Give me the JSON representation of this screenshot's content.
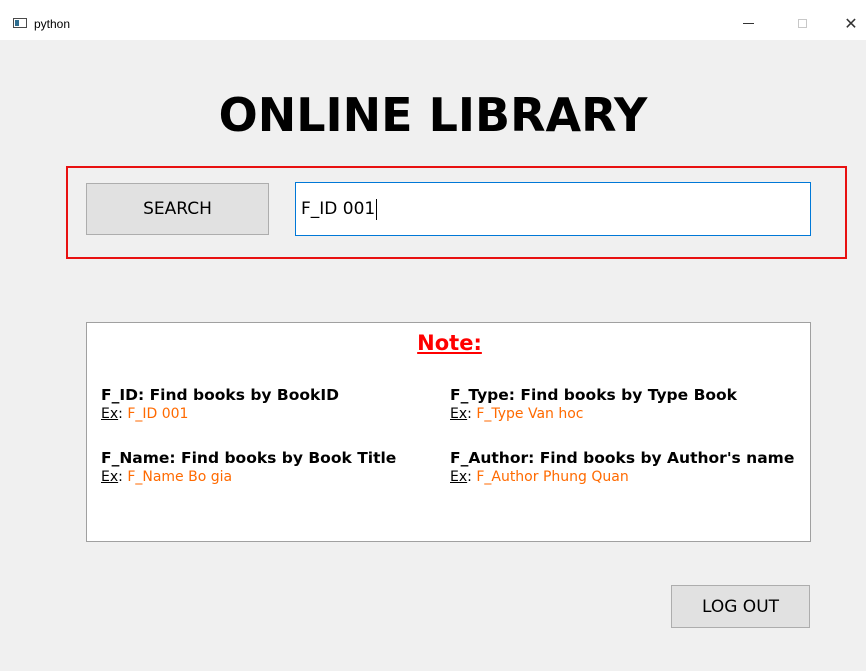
{
  "window": {
    "title": "python",
    "minimize_glyph": "—",
    "close_glyph": "✕"
  },
  "main": {
    "title": "ONLINE LIBRARY"
  },
  "search": {
    "button_label": "SEARCH",
    "input_value": "F_ID 001"
  },
  "note": {
    "title": "Note:",
    "example_label": "Ex",
    "example_colon": ": ",
    "items": [
      {
        "heading": "F_ID: Find books by BookID",
        "example": "F_ID 001"
      },
      {
        "heading": "F_Type: Find books by Type Book",
        "example": "F_Type Van hoc"
      },
      {
        "heading": "F_Name: Find books by Book Title",
        "example": "F_Name Bo gia"
      },
      {
        "heading": "F_Author: Find books by Author's name",
        "example": "F_Author Phung Quan"
      }
    ]
  },
  "footer": {
    "logout_label": "LOG OUT"
  },
  "colors": {
    "frame_red": "#e81010",
    "note_title_red": "#ff0000",
    "example_orange": "#ff6a00",
    "input_focus_blue": "#0078d7"
  },
  "icons": {
    "app": "app-window-icon",
    "minimize": "minimize-icon",
    "maximize": "maximize-icon",
    "close": "close-icon"
  }
}
